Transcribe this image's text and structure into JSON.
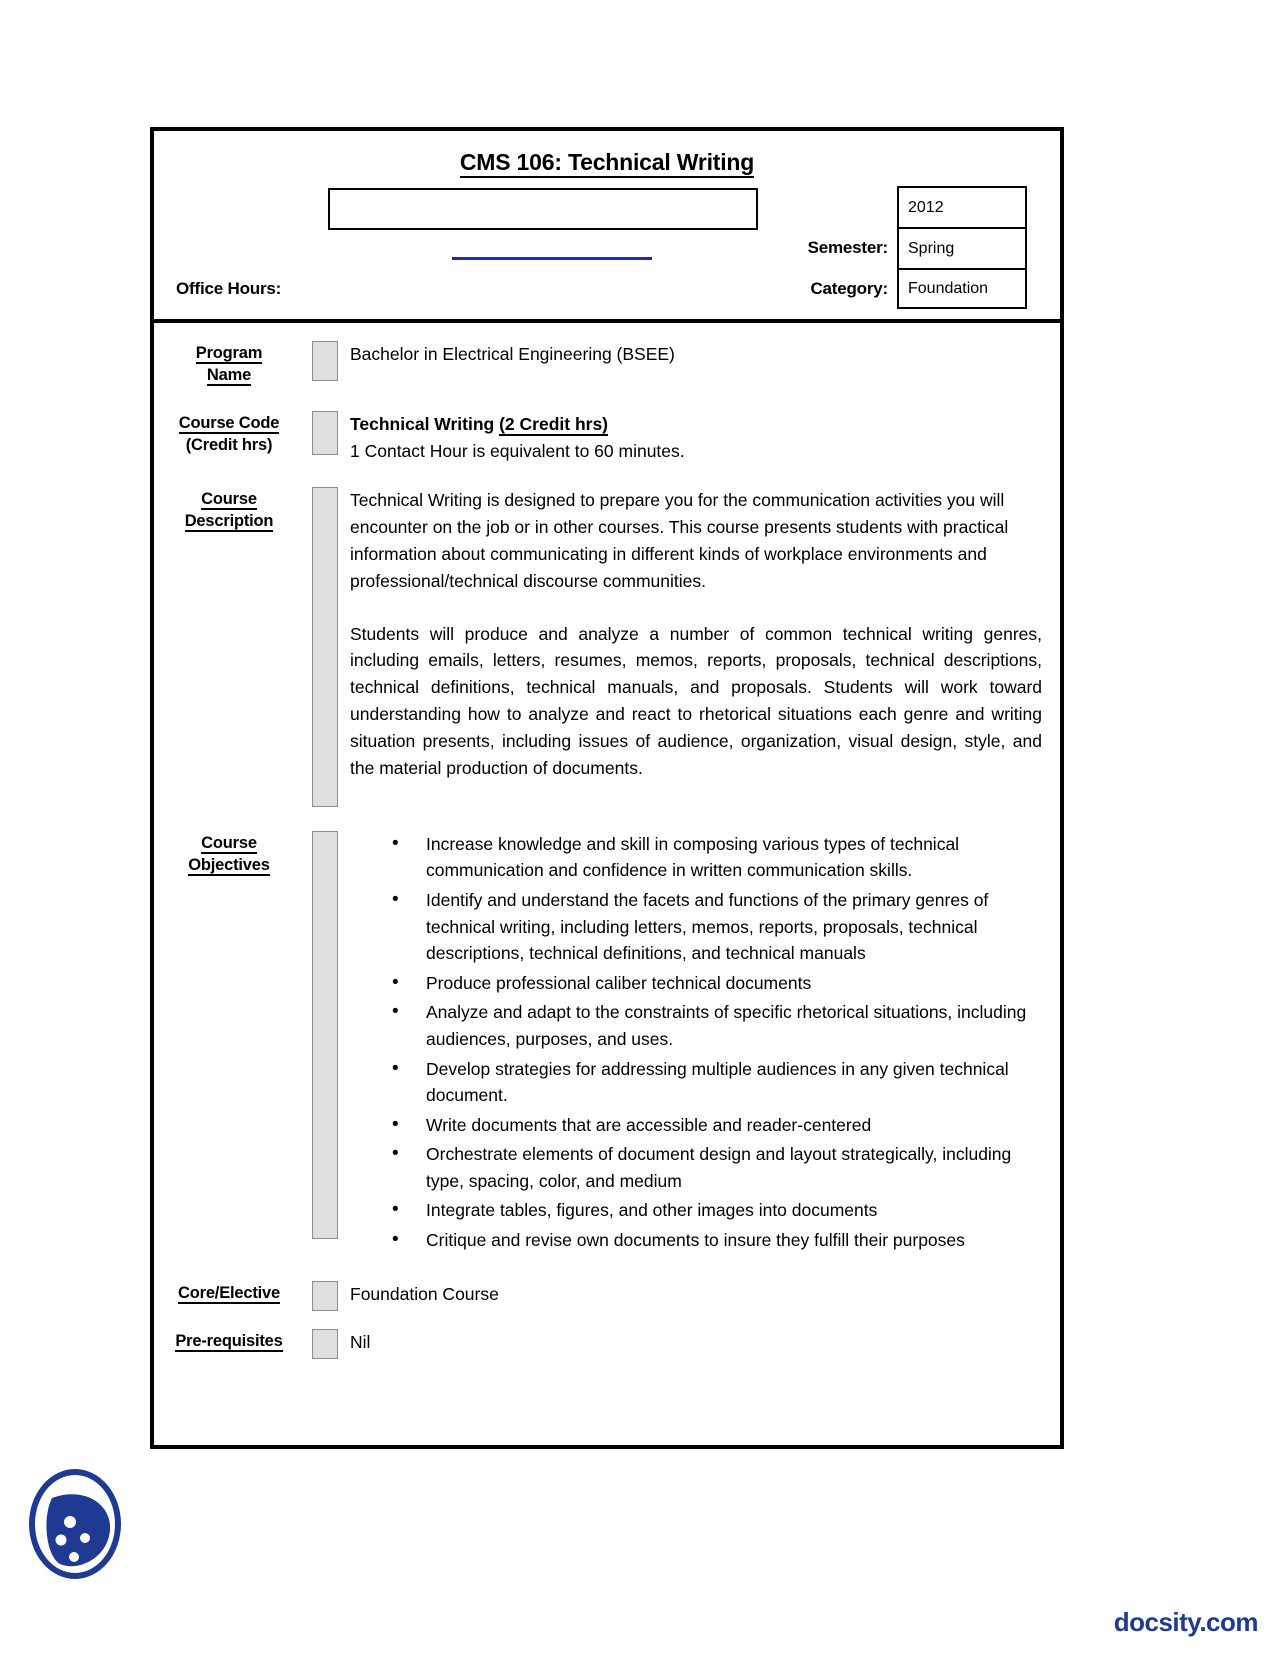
{
  "document": {
    "title": "CMS 106: Technical Writing",
    "office_hours_label": "Office Hours:",
    "instructor_field_value": "",
    "meta": {
      "year": "2012",
      "semester_label": "Semester:",
      "semester_value": "Spring",
      "category_label": "Category:",
      "category_value": "Foundation"
    },
    "rows": {
      "program": {
        "label_line1": "Program",
        "label_line2": "Name",
        "value": "Bachelor in Electrical Engineering (BSEE)"
      },
      "course_code": {
        "label_line1": "Course Code",
        "label_line2": "(Credit hrs)",
        "title": "Technical Writing ",
        "credits": "(2 Credit hrs)",
        "note": "1 Contact Hour is equivalent to 60 minutes."
      },
      "description": {
        "label_line1": "Course",
        "label_line2": "Description",
        "paragraph1": "Technical Writing is designed to prepare you for the communication activities you will encounter on the job or in other courses. This course presents students with practical information about communicating in different kinds of workplace environments and professional/technical discourse communities.",
        "paragraph2": "Students will produce and analyze a number of common technical writing genres, including emails, letters, resumes, memos, reports, proposals, technical descriptions, technical definitions, technical manuals, and proposals. Students will work toward understanding how to analyze and react to rhetorical situations each genre and writing situation presents, including issues of audience, organization, visual design, style, and the material production of documents."
      },
      "objectives": {
        "label_line1": "Course",
        "label_line2": "Objectives",
        "items": [
          "Increase knowledge and skill in composing various types of technical communication and confidence in written communication skills.",
          "Identify and understand the facets and functions of the primary genres of technical writing, including letters, memos,  reports, proposals, technical descriptions, technical definitions, and technical manuals",
          "Produce professional caliber technical documents",
          "Analyze and adapt to the constraints of specific rhetorical situations, including audiences, purposes, and uses.",
          "Develop strategies for addressing multiple audiences in any given technical document.",
          "Write documents that are accessible and reader-centered",
          "Orchestrate elements of document design and layout strategically, including type, spacing, color, and medium",
          "Integrate tables, figures, and other images into documents",
          "Critique and revise own documents to insure they fulfill their purposes"
        ]
      },
      "core_elective": {
        "label": "Core/Elective",
        "value": "Foundation Course"
      },
      "prerequisites": {
        "label": "Pre-requisites",
        "value": "Nil"
      }
    }
  },
  "footer": {
    "watermark_text": "docsity.com",
    "watermark_color": "#1f3a93",
    "logo_icon": "docsity-cookie-logo"
  }
}
